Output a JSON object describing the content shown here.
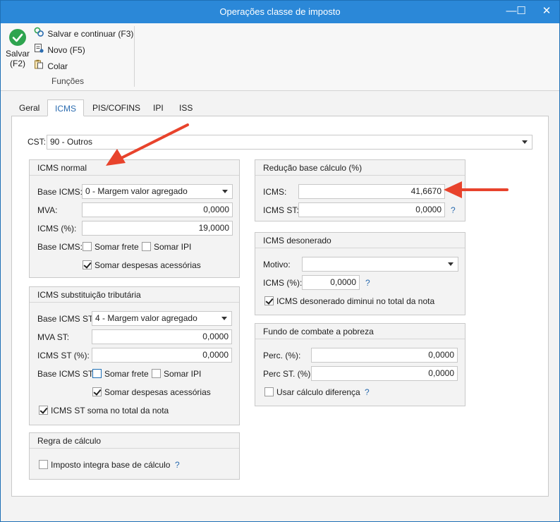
{
  "window": {
    "title": "Operações classe de imposto",
    "minimize": "—",
    "maximize": "☐",
    "close": "✕"
  },
  "ribbon": {
    "save_label_1": "Salvar",
    "save_label_2": "(F2)",
    "save_continue": "Salvar e continuar (F3)",
    "new": "Novo (F5)",
    "paste": "Colar",
    "group": "Funções"
  },
  "tabs": [
    "Geral",
    "ICMS",
    "PIS/COFINS",
    "IPI",
    "ISS"
  ],
  "cst": {
    "label": "CST:",
    "value": "90 - Outros"
  },
  "icms_normal": {
    "title": "ICMS normal",
    "base_label": "Base ICMS:",
    "base_value": "0 - Margem valor agregado",
    "mva_label": "MVA:",
    "mva_value": "0,0000",
    "icms_label": "ICMS (%):",
    "icms_value": "19,0000",
    "base2_label": "Base ICMS:",
    "somar_frete": "Somar frete",
    "somar_ipi": "Somar IPI",
    "somar_despesas": "Somar despesas acessórias"
  },
  "icms_st": {
    "title": "ICMS substituição tributária",
    "base_label": "Base ICMS ST:",
    "base_value": "4 - Margem valor agregado",
    "mva_label": "MVA ST:",
    "mva_value": "0,0000",
    "icms_label": "ICMS ST (%):",
    "icms_value": "0,0000",
    "base2_label": "Base ICMS ST:",
    "somar_frete": "Somar frete",
    "somar_ipi": "Somar IPI",
    "somar_despesas": "Somar despesas acessórias",
    "soma_total": "ICMS ST soma no total da nota"
  },
  "regra": {
    "title": "Regra de cálculo",
    "integra": "Imposto integra base de cálculo",
    "help": "?"
  },
  "reducao": {
    "title": "Redução base cálculo (%)",
    "icms_label": "ICMS:",
    "icms_value": "41,6670",
    "icms_st_label": "ICMS ST:",
    "icms_st_value": "0,0000",
    "help": "?"
  },
  "desonerado": {
    "title": "ICMS desonerado",
    "motivo_label": "Motivo:",
    "motivo_value": "",
    "icms_label": "ICMS (%):",
    "icms_value": "0,0000",
    "help": "?",
    "diminui": "ICMS desonerado diminui no total da nota"
  },
  "fcp": {
    "title": "Fundo de combate a pobreza",
    "perc_label": "Perc. (%):",
    "perc_value": "0,0000",
    "perc_st_label": "Perc ST. (%):",
    "perc_st_value": "0,0000",
    "diferenca": "Usar cálculo diferença",
    "help": "?"
  },
  "colors": {
    "accent": "#2b88d8",
    "arrow": "#e8432c",
    "check": "#2ea44f"
  }
}
